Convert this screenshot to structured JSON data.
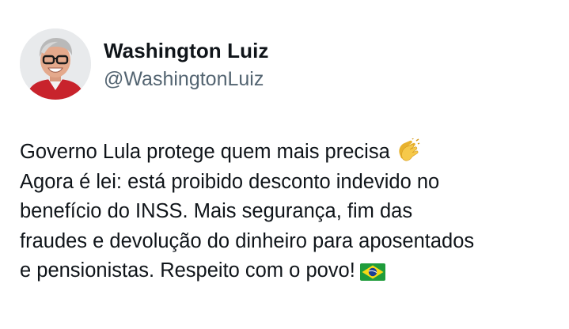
{
  "author": {
    "display_name": "Washington Luiz",
    "handle": "@WashingtonLuiz"
  },
  "tweet": {
    "lines": [
      "Governo Lula protege quem mais precisa",
      "Agora é lei: está proibido desconto indevido no",
      "benefício do INSS. Mais segurança, fim das",
      "fraudes e devolução do dinheiro para aposentados",
      "e pensionistas. Respeito com o povo!"
    ],
    "emojis": [
      "clapping-hands-icon",
      "brazil-flag-icon"
    ]
  },
  "colors": {
    "text": "#0f1419",
    "secondary_text": "#536471",
    "background": "#ffffff",
    "flag_green": "#1f9c3b",
    "flag_yellow": "#f7d917",
    "flag_blue": "#1c3f94"
  }
}
